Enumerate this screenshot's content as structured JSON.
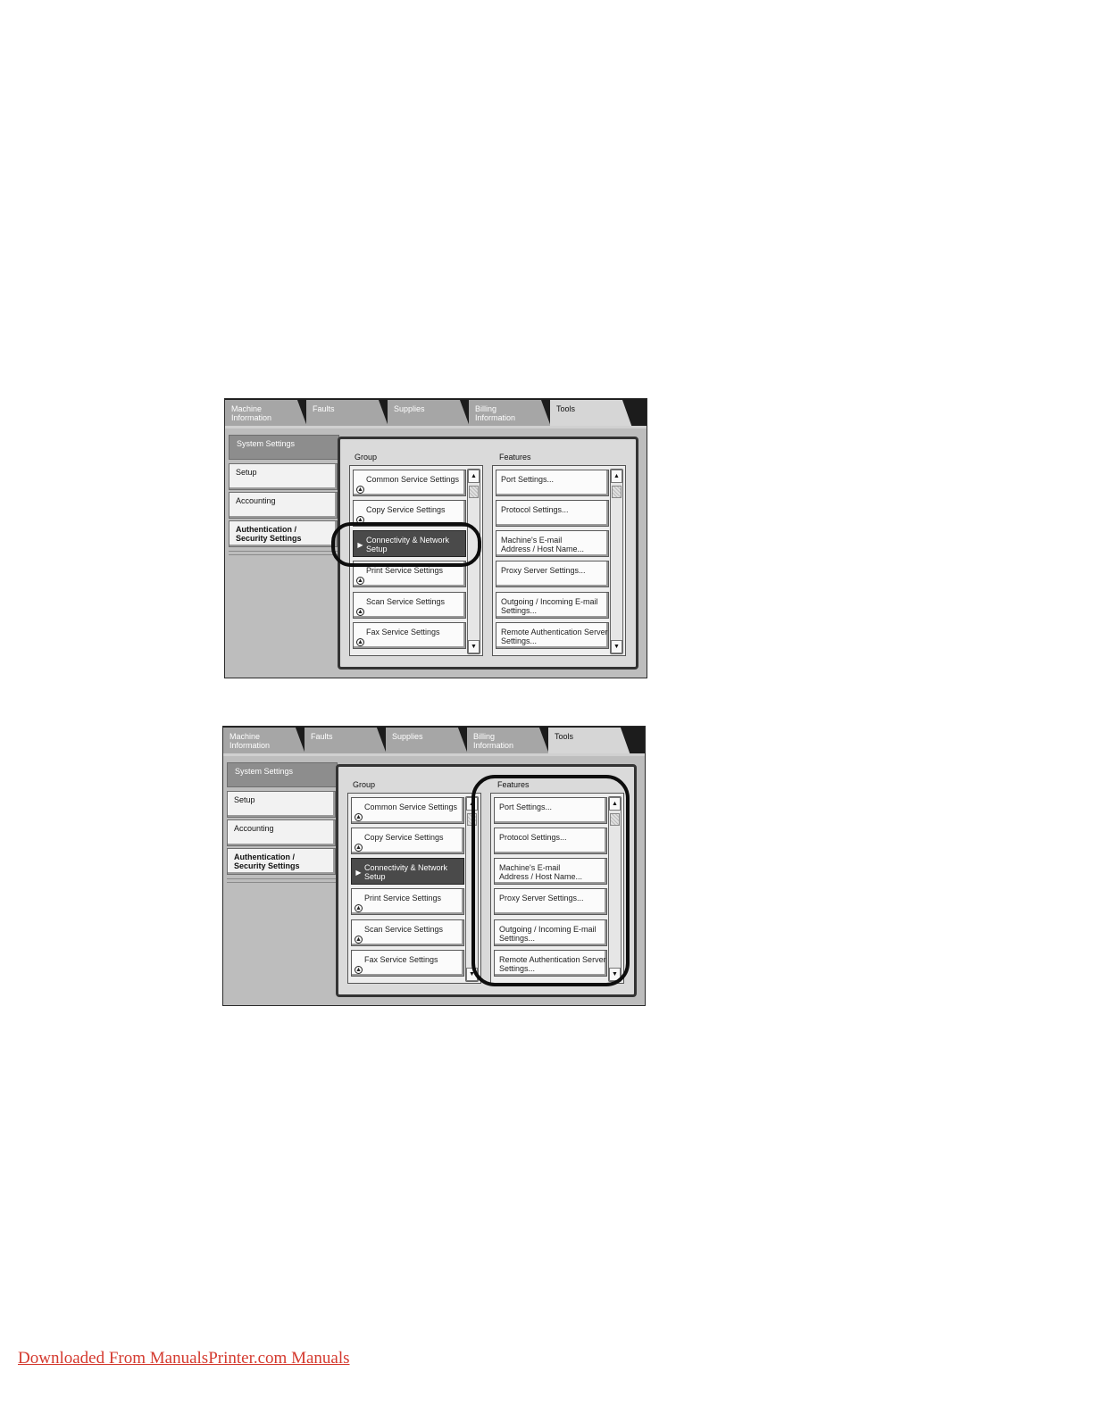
{
  "screenshots": [
    {
      "tabs": [
        "Machine\nInformation",
        "Faults",
        "Supplies",
        "Billing\nInformation",
        "Tools"
      ],
      "active_tab": "Tools",
      "left_menu": {
        "header": "System Settings",
        "items": [
          "Setup",
          "Accounting",
          "Authentication /\nSecurity Settings"
        ]
      },
      "group_label": "Group",
      "features_label": "Features",
      "group_items": [
        "Common Service Settings",
        "Copy Service Settings",
        "Connectivity & Network Setup",
        "Print Service Settings",
        "Scan Service Settings",
        "Fax Service Settings"
      ],
      "selected_group": "Connectivity & Network Setup",
      "feature_items": [
        "Port Settings...",
        "Protocol Settings...",
        "Machine's E-mail\nAddress / Host Name...",
        "Proxy Server Settings...",
        "Outgoing / Incoming E-mail\nSettings...",
        "Remote Authentication Server\nSettings..."
      ],
      "callout": "Connectivity & Network Setup"
    },
    {
      "tabs": [
        "Machine\nInformation",
        "Faults",
        "Supplies",
        "Billing\nInformation",
        "Tools"
      ],
      "active_tab": "Tools",
      "left_menu": {
        "header": "System Settings",
        "items": [
          "Setup",
          "Accounting",
          "Authentication /\nSecurity Settings"
        ]
      },
      "group_label": "Group",
      "features_label": "Features",
      "group_items": [
        "Common Service Settings",
        "Copy Service Settings",
        "Connectivity & Network Setup",
        "Print Service Settings",
        "Scan Service Settings",
        "Fax Service Settings"
      ],
      "selected_group": "Connectivity & Network Setup",
      "feature_items": [
        "Port Settings...",
        "Protocol Settings...",
        "Machine's E-mail\nAddress / Host Name...",
        "Proxy Server Settings...",
        "Outgoing / Incoming E-mail\nSettings...",
        "Remote Authentication Server\nSettings..."
      ],
      "callout": "Features"
    }
  ],
  "footer": {
    "link_text": "Downloaded From ManualsPrinter.com Manuals",
    "link_color": "#d4392e"
  },
  "icons": {
    "group_item": "service-circle-icon",
    "selected_group": "play-arrow-icon",
    "scroll_up": "scroll-up-arrow-icon",
    "scroll_down": "scroll-down-arrow-icon"
  }
}
